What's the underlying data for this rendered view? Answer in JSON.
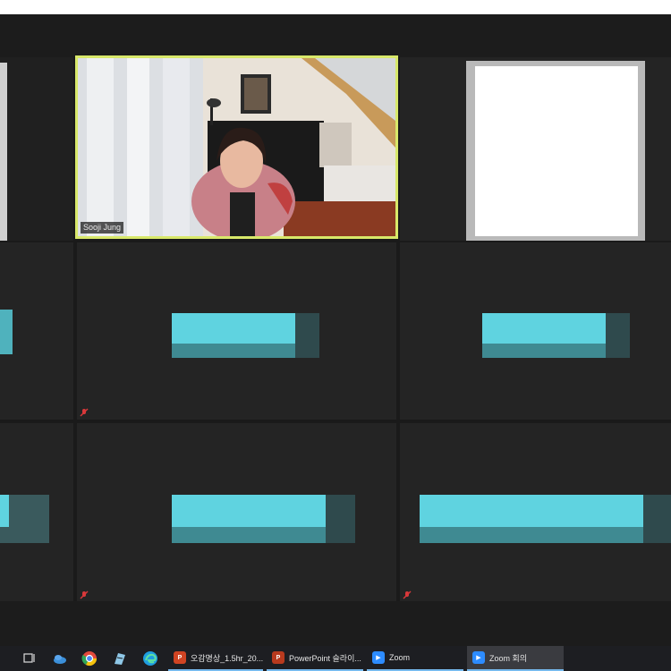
{
  "meeting": {
    "active_speaker": {
      "name": "Sooji Jung"
    }
  },
  "colors": {
    "active_border": "#d8e86a",
    "placeholder_bar": "#5fd3e0",
    "tile_bg": "#242424",
    "mute_red": "#d9383a"
  },
  "taskbar": {
    "apps": [
      {
        "label": "오감명상_1.5hr_20...",
        "icon": "powerpoint-icon",
        "color": "#d04423"
      },
      {
        "label": "PowerPoint 슬라이...",
        "icon": "powerpoint-slideshow-icon",
        "color": "#b83a1e"
      },
      {
        "label": "Zoom",
        "icon": "zoom-icon",
        "color": "#2d8cff"
      },
      {
        "label": "Zoom 회의",
        "icon": "zoom-meeting-icon",
        "color": "#2d8cff"
      }
    ],
    "pinned": [
      "task-view-icon",
      "cloud-icon",
      "chrome-icon",
      "notepad-icon",
      "edge-icon"
    ]
  }
}
